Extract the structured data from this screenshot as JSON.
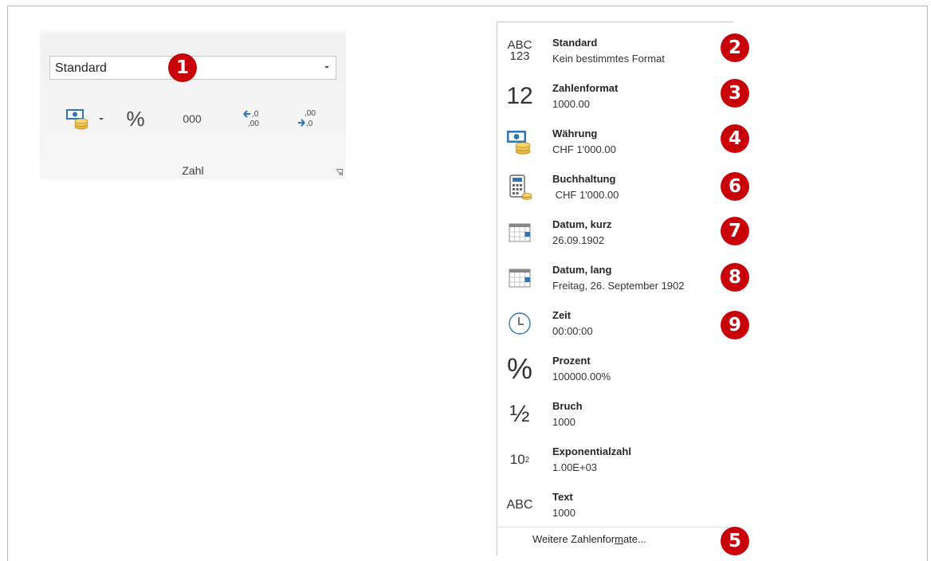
{
  "ribbon": {
    "selected_format": "Standard",
    "percent_label": "%",
    "thousands_label": "000",
    "group_label": "Zahl"
  },
  "markers": [
    "1",
    "2",
    "3",
    "4",
    "5",
    "6",
    "7",
    "8",
    "9"
  ],
  "menu": {
    "items": [
      {
        "icon": "abc-123-icon",
        "icon_text_top": "ABC",
        "icon_text_bottom": "123",
        "name": "Standard",
        "sample": "Kein bestimmtes Format"
      },
      {
        "icon": "number-12-icon",
        "icon_text": "12",
        "name": "Zahlenformat",
        "sample": "1000.00"
      },
      {
        "icon": "currency-icon",
        "name": "Währung",
        "sample": "CHF 1'000.00"
      },
      {
        "icon": "calculator-icon",
        "name": "Buchhaltung",
        "sample": " CHF 1'000.00"
      },
      {
        "icon": "calendar-icon",
        "name": "Datum, kurz",
        "sample": "26.09.1902"
      },
      {
        "icon": "calendar-icon",
        "name": "Datum, lang",
        "sample": "Freitag, 26. September 1902"
      },
      {
        "icon": "clock-icon",
        "name": "Zeit",
        "sample": "00:00:00"
      },
      {
        "icon": "percent-icon",
        "icon_text": "%",
        "name": "Prozent",
        "sample": "100000.00%"
      },
      {
        "icon": "fraction-icon",
        "icon_text": "½",
        "name": "Bruch",
        "sample": "1000"
      },
      {
        "icon": "exponent-icon",
        "icon_text": "10",
        "icon_sup": "2",
        "name": "Exponentialzahl",
        "sample": "1.00E+03"
      },
      {
        "icon": "text-abc-icon",
        "icon_text": "ABC",
        "name": "Text",
        "sample": "1000"
      }
    ],
    "more_formats_pre": "Weitere Zahlenfor",
    "more_formats_u": "m",
    "more_formats_post": "ate..."
  },
  "colors": {
    "marker": "#c8000a",
    "icon_blue": "#2e75b6",
    "coin_gold": "#e8b93c"
  }
}
